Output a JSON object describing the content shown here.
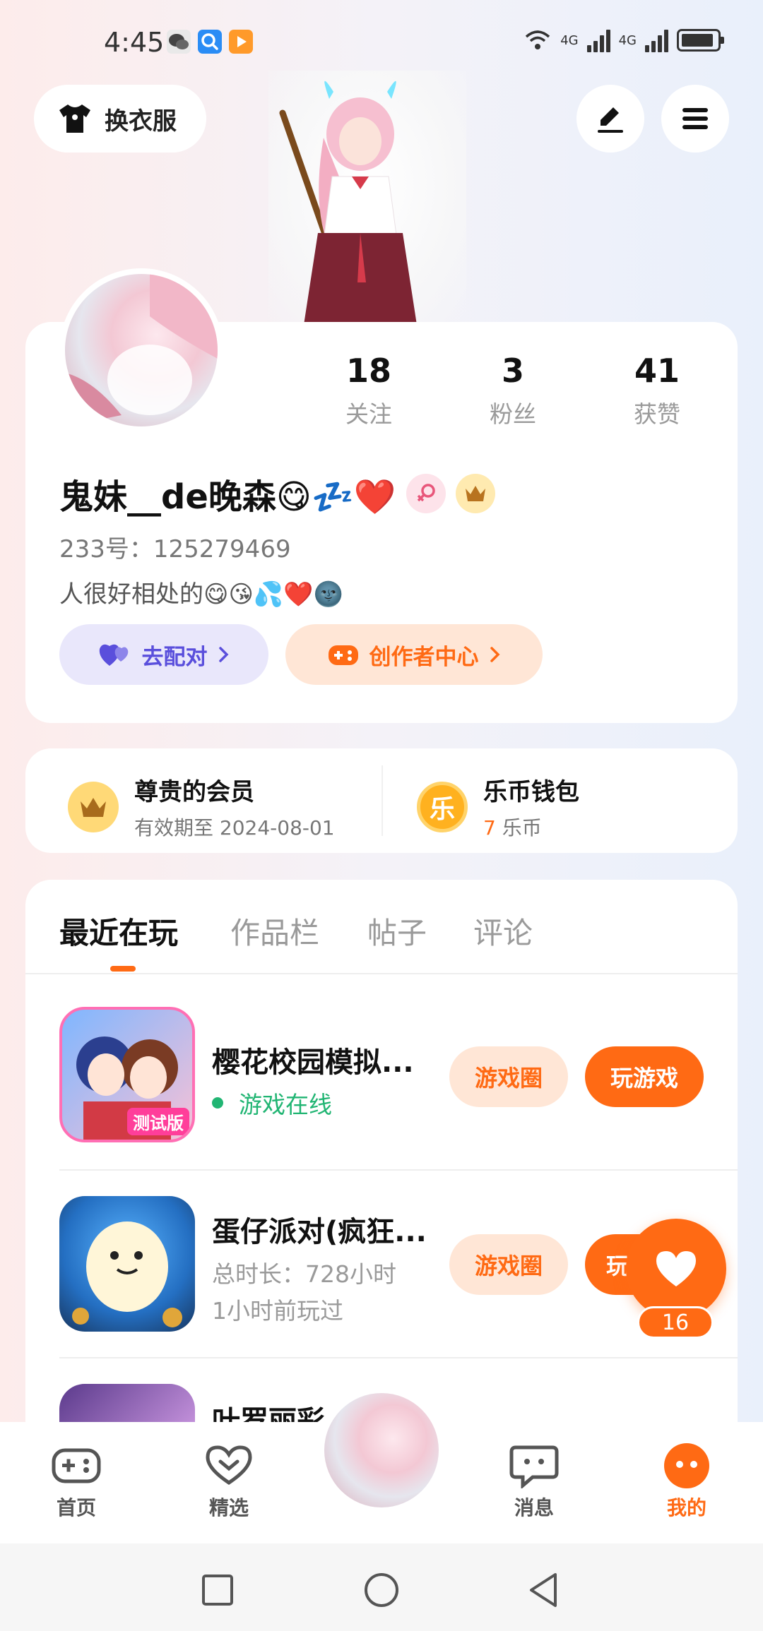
{
  "status_bar": {
    "time": "4:45",
    "net1": "4G",
    "net2": "4G"
  },
  "top_bar": {
    "outfit_label": "换衣服"
  },
  "profile": {
    "stats": [
      {
        "value": "18",
        "label": "关注"
      },
      {
        "value": "3",
        "label": "粉丝"
      },
      {
        "value": "41",
        "label": "获赞"
      }
    ],
    "username": "鬼妹__de晚森😋💤❤️",
    "uid_text": "233号：125279469",
    "bio": "人很好相处的😋😘💦❤️🌚",
    "match_label": "去配对",
    "creator_label": "创作者中心"
  },
  "membership": {
    "title": "尊贵的会员",
    "expiry": "有效期至 2024-08-01"
  },
  "wallet": {
    "title": "乐币钱包",
    "coin_glyph": "乐",
    "amount": "7",
    "unit": "乐币"
  },
  "tabs": [
    "最近在玩",
    "作品栏",
    "帖子",
    "评论"
  ],
  "games": [
    {
      "name": "樱花校园模拟...",
      "status": "游戏在线",
      "circle_label": "游戏圈",
      "play_label": "玩游戏",
      "badge": "测试版"
    },
    {
      "name": "蛋仔派对(疯狂...",
      "duration": "总时长：728小时",
      "last_played": "1小时前玩过",
      "circle_label": "游戏圈",
      "play_label": "玩"
    },
    {
      "name": "叶罗丽彩"
    }
  ],
  "like_fab": {
    "count": "16"
  },
  "bottom_nav": [
    {
      "label": "首页"
    },
    {
      "label": "精选"
    },
    {
      "label": "消息"
    },
    {
      "label": "我的"
    }
  ],
  "colors": {
    "accent": "#ff6a14",
    "match_bg": "#e9e7fb",
    "match_fg": "#5a4fdc",
    "creator_bg": "#ffe6d6",
    "online": "#21b573"
  }
}
